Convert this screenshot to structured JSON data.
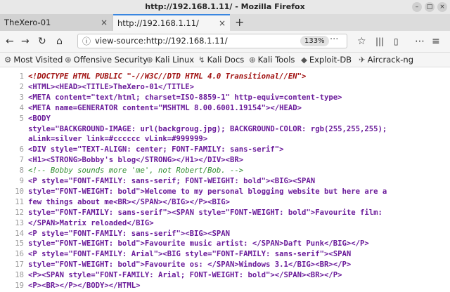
{
  "window": {
    "title": "http://192.168.1.11/ - Mozilla Firefox"
  },
  "tabs": [
    {
      "label": "TheXero-01"
    },
    {
      "label": "http://192.168.1.11/"
    }
  ],
  "address_bar": {
    "value": "view-source:http://192.168.1.11/",
    "zoom": "133%"
  },
  "bookmarks": [
    {
      "label": "Most Visited",
      "icon": "gear-icon"
    },
    {
      "label": "Offensive Security",
      "icon": "globe-icon"
    },
    {
      "label": "Kali Linux",
      "icon": "globe-icon"
    },
    {
      "label": "Kali Docs",
      "icon": "kali-icon"
    },
    {
      "label": "Kali Tools",
      "icon": "globe-icon"
    },
    {
      "label": "Exploit-DB",
      "icon": "db-icon"
    },
    {
      "label": "Aircrack-ng",
      "icon": "aircrack-icon"
    }
  ],
  "source_lines": [
    {
      "num": "1",
      "text": "<!DOCTYPE HTML PUBLIC \"-//W3C//DTD HTML 4.0 Transitional//EN\">",
      "style": "doctype"
    },
    {
      "num": "2",
      "text": "<HTML><HEAD><TITLE>TheXero-01</TITLE>",
      "style": "tag"
    },
    {
      "num": "3",
      "text": "<META content=\"text/html; charset=ISO-8859-1\" http-equiv=content-type>",
      "style": "tag"
    },
    {
      "num": "4",
      "text": "<META name=GENERATOR content=\"MSHTML 8.00.6001.19154\"></HEAD>",
      "style": "tag"
    },
    {
      "num": "5",
      "text": "<BODY",
      "style": "tag"
    },
    {
      "num": "",
      "text": "style=\"BACKGROUND-IMAGE: url(backgroug.jpg); BACKGROUND-COLOR: rgb(255,255,255);",
      "style": "tag"
    },
    {
      "num": "",
      "text": "aLink=silver link=#cccccc vLink=#999999>",
      "style": "tag"
    },
    {
      "num": "6",
      "text": "<DIV style=\"TEXT-ALIGN: center; FONT-FAMILY: sans-serif\">",
      "style": "tag"
    },
    {
      "num": "7",
      "text": "<H1><STRONG>Bobby's blog</STRONG></H1></DIV><BR>",
      "style": "tag"
    },
    {
      "num": "8",
      "text": "<!-- Bobby sounds more 'me', not Robert/Bob. -->",
      "style": "comment"
    },
    {
      "num": "9",
      "text": "<P style=\"FONT-FAMILY: sans-serif; FONT-WEIGHT: bold\"><BIG><SPAN",
      "style": "tag"
    },
    {
      "num": "10",
      "text": "style=\"FONT-WEIGHT: bold\">Welcome to my personal blogging website but here are a",
      "style": "tag"
    },
    {
      "num": "11",
      "text": "few things about me<BR></SPAN></BIG></P><BIG>",
      "style": "tag"
    },
    {
      "num": "12",
      "text": "style=\"FONT-FAMILY: sans-serif\"><SPAN style=\"FONT-WEIGHT: bold\">Favourite film:",
      "style": "tag"
    },
    {
      "num": "13",
      "text": "</SPAN>Matrix reloaded</BIG>",
      "style": "tag"
    },
    {
      "num": "14",
      "text": "<P style=\"FONT-FAMILY: sans-serif\"><BIG><SPAN",
      "style": "tag"
    },
    {
      "num": "15",
      "text": "style=\"FONT-WEIGHT: bold\">Favourite music artist: </SPAN>Daft Punk</BIG></P>",
      "style": "tag"
    },
    {
      "num": "16",
      "text": "<P style=\"FONT-FAMILY: Arial\"><BIG style=\"FONT-FAMILY: sans-serif\"><SPAN",
      "style": "tag"
    },
    {
      "num": "17",
      "text": "style=\"FONT-WEIGHT: bold\">Favourite os: </SPAN>Windows 3.1</BIG><BR></P>",
      "style": "tag"
    },
    {
      "num": "18",
      "text": "<P><SPAN style=\"FONT-FAMILY: Arial; FONT-WEIGHT: bold\"></SPAN><BR></P>",
      "style": "tag"
    },
    {
      "num": "19",
      "text": "<P><BR></P></BODY></HTML>",
      "style": "tag"
    },
    {
      "num": "20",
      "text": "",
      "style": "tag"
    }
  ]
}
